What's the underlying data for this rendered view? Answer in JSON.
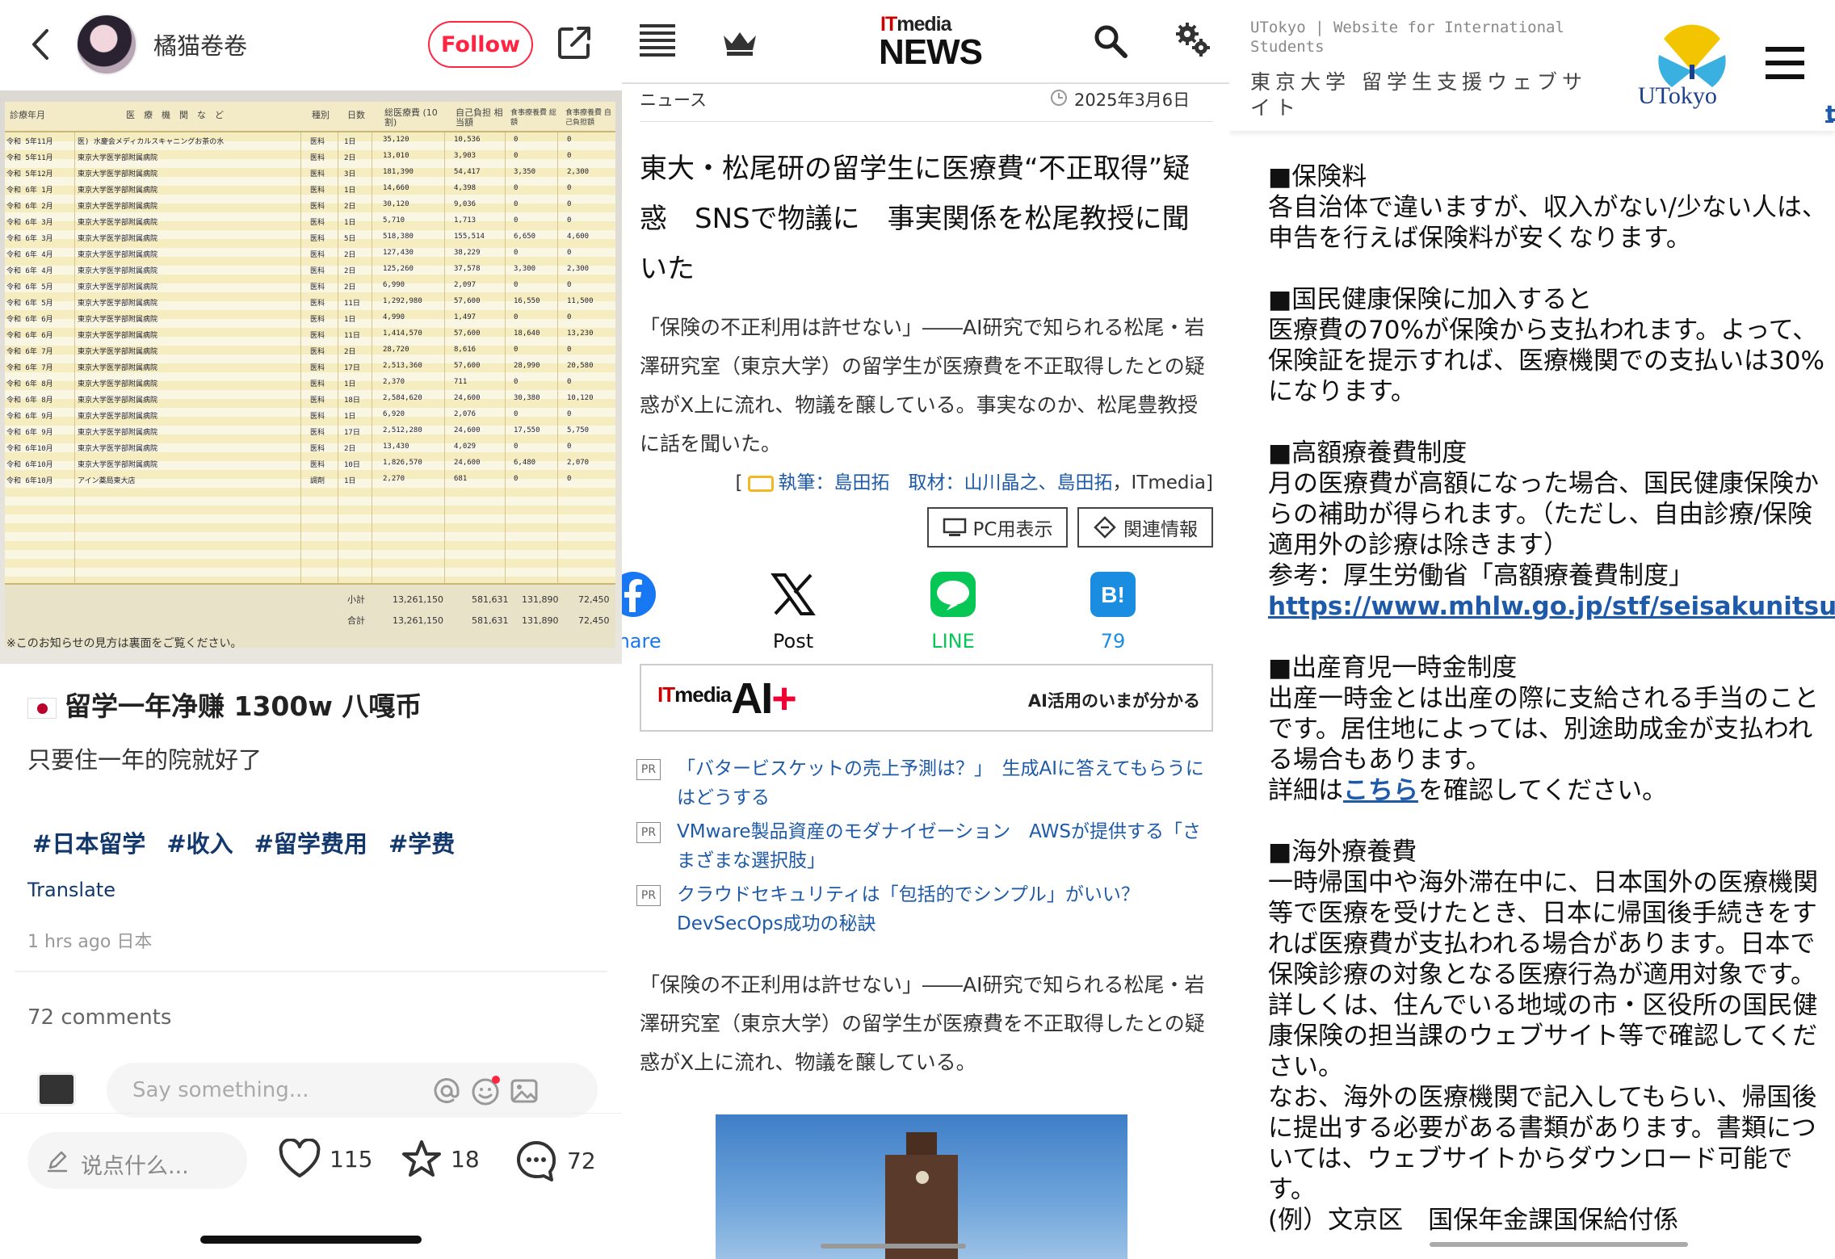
{
  "panel1": {
    "username": "橘猫卷卷",
    "follow_label": "Follow",
    "receipt": {
      "headers": [
        "診療年月",
        "医　療　機　関　な　ど",
        "種別",
        "日数",
        "総医療費\n(10割)",
        "自己負担\n相当額",
        "食事療養費\n総額",
        "食事療養費\n自己負担額"
      ],
      "rows": [
        [
          "令和 5年11月",
          "医) 水慶会メディカルスキャニングお茶の水",
          "医科",
          "1日",
          "35,120",
          "10,536",
          "0",
          "0"
        ],
        [
          "令和 5年11月",
          "東京大学医学部附属病院",
          "医科",
          "2日",
          "13,010",
          "3,903",
          "0",
          "0"
        ],
        [
          "令和 5年12月",
          "東京大学医学部附属病院",
          "医科",
          "3日",
          "181,390",
          "54,417",
          "3,350",
          "2,300"
        ],
        [
          "令和 6年 1月",
          "東京大学医学部附属病院",
          "医科",
          "1日",
          "14,660",
          "4,398",
          "0",
          "0"
        ],
        [
          "令和 6年 2月",
          "東京大学医学部附属病院",
          "医科",
          "2日",
          "30,120",
          "9,036",
          "0",
          "0"
        ],
        [
          "令和 6年 3月",
          "東京大学医学部附属病院",
          "医科",
          "1日",
          "5,710",
          "1,713",
          "0",
          "0"
        ],
        [
          "令和 6年 3月",
          "東京大学医学部附属病院",
          "医科",
          "5日",
          "518,380",
          "155,514",
          "6,650",
          "4,600"
        ],
        [
          "令和 6年 4月",
          "東京大学医学部附属病院",
          "医科",
          "2日",
          "127,430",
          "38,229",
          "0",
          "0"
        ],
        [
          "令和 6年 4月",
          "東京大学医学部附属病院",
          "医科",
          "2日",
          "125,260",
          "37,578",
          "3,300",
          "2,300"
        ],
        [
          "令和 6年 5月",
          "東京大学医学部附属病院",
          "医科",
          "2日",
          "6,990",
          "2,097",
          "0",
          "0"
        ],
        [
          "令和 6年 5月",
          "東京大学医学部附属病院",
          "医科",
          "11日",
          "1,292,980",
          "57,600",
          "16,550",
          "11,500"
        ],
        [
          "令和 6年 6月",
          "東京大学医学部附属病院",
          "医科",
          "1日",
          "4,990",
          "1,497",
          "0",
          "0"
        ],
        [
          "令和 6年 6月",
          "東京大学医学部附属病院",
          "医科",
          "11日",
          "1,414,570",
          "57,600",
          "18,640",
          "13,230"
        ],
        [
          "令和 6年 7月",
          "東京大学医学部附属病院",
          "医科",
          "2日",
          "28,720",
          "8,616",
          "0",
          "0"
        ],
        [
          "令和 6年 7月",
          "東京大学医学部附属病院",
          "医科",
          "17日",
          "2,513,360",
          "57,600",
          "28,990",
          "20,580"
        ],
        [
          "令和 6年 8月",
          "東京大学医学部附属病院",
          "医科",
          "1日",
          "2,370",
          "711",
          "0",
          "0"
        ],
        [
          "令和 6年 8月",
          "東京大学医学部附属病院",
          "医科",
          "18日",
          "2,584,620",
          "24,600",
          "30,380",
          "10,120"
        ],
        [
          "令和 6年 9月",
          "東京大学医学部附属病院",
          "医科",
          "1日",
          "6,920",
          "2,076",
          "0",
          "0"
        ],
        [
          "令和 6年 9月",
          "東京大学医学部附属病院",
          "医科",
          "17日",
          "2,512,280",
          "24,600",
          "17,550",
          "5,750"
        ],
        [
          "令和 6年10月",
          "東京大学医学部附属病院",
          "医科",
          "2日",
          "13,430",
          "4,029",
          "0",
          "0"
        ],
        [
          "令和 6年10月",
          "東京大学医学部附属病院",
          "医科",
          "10日",
          "1,826,570",
          "24,600",
          "6,480",
          "2,070"
        ],
        [
          "令和 6年10月",
          "アイン薬局東大店",
          "調剤",
          "1日",
          "2,270",
          "681",
          "0",
          "0"
        ]
      ],
      "subtotal_label": "小計",
      "total_label": "合計",
      "subtotal": [
        "13,261,150",
        "581,631",
        "131,890",
        "72,450"
      ],
      "total": [
        "13,261,150",
        "581,631",
        "131,890",
        "72,450"
      ],
      "note": "※このお知らせの見方は裏面をご覧ください。"
    },
    "title": "留学一年净赚 1300w 八嘎币",
    "text": "只要住一年的院就好了",
    "tags": [
      "#日本留学",
      "#收入",
      "#留学费用",
      "#学费"
    ],
    "translate": "Translate",
    "time": "1 hrs ago 日本",
    "comments_count": "72 comments",
    "comment_placeholder": "Say something...",
    "bottom_input": "说点什么...",
    "likes": "115",
    "stars": "18",
    "comments": "72"
  },
  "panel2": {
    "logo_it": "IT",
    "logo_media": "media",
    "logo_news": "NEWS",
    "section": "ニュース",
    "date": "2025年3月6日",
    "title": "東大・松尾研の留学生に医療費“不正取得”疑惑　SNSで物議に　事実関係を松尾教授に聞いた",
    "lead": "「保険の不正利用は許せない」――AI研究で知られる松尾・岩澤研究室（東京大学）の留学生が医療費を不正取得したとの疑惑がX上に流れ、物議を醸している。事実なのか、松尾豊教授に話を聞いた。",
    "byline_open": "[",
    "byline_author": "執筆：島田拓",
    "byline_reporters": "取材：山川晶之、島田拓",
    "byline_source": "ITmedia",
    "byline_close": "]",
    "pc_view": "PC用表示",
    "related": "関連情報",
    "sns": [
      {
        "label": "Share",
        "color": "#1877f2"
      },
      {
        "label": "Post",
        "color": "#111111"
      },
      {
        "label": "LINE",
        "color": "#06c755"
      },
      {
        "label": "79",
        "color": "#1a8de0"
      }
    ],
    "line_icon_text": "LINE",
    "hatena_icon_text": "B!",
    "ai_banner_it": "IT",
    "ai_banner_media": "media",
    "ai_banner_ai": "AI",
    "ai_banner_plus": "+",
    "ai_tagline": "AI活用のいまが分かる",
    "pr_badge": "PR",
    "pr_items": [
      "「バタービスケットの売上予測は？」　生成AIに答えてもらうにはどうする",
      "VMware製品資産のモダナイゼーション　AWSが提供する「さまざまな選択肢」",
      "クラウドセキュリティは「包括的でシンプル」がいい？　DevSecOps成功の秘訣"
    ],
    "body": "「保険の不正利用は許せない」――AI研究で知られる松尾・岩澤研究室（東京大学）の留学生が医療費を不正取得したとの疑惑がX上に流れ、物議を醸している。"
  },
  "panel3": {
    "site_en": "UTokyo | Website for International Students",
    "site_jp": "東京大学 留学生支援ウェブサイト",
    "logo_text": "UTokyo",
    "edge_letter": "t",
    "sections": [
      {
        "heading": "■保険料",
        "lines": [
          "各自治体で違いますが、収入がない/少ない人は、申告を行えば保険料が安くなります。"
        ]
      },
      {
        "heading": "■国民健康保険に加入すると",
        "lines": [
          "医療費の70%が保険から支払われます。よって、保険証を提示すれば、医療機関での支払いは30%になります。"
        ]
      },
      {
        "heading": "■高額療養費制度",
        "lines": [
          "月の医療費が高額になった場合、国民健康保険からの補助が得られます。（ただし、自由診療/保険適用外の診療は除きます）",
          "参考：厚生労働省「高額療養費制度」"
        ],
        "link": "https://www.mhlw.go.jp/stf/seisakunitsuite/bun"
      },
      {
        "heading": "■出産育児一時金制度",
        "lines": [
          "出産一時金とは出産の際に支給される手当のことです。居住地によっては、別途助成金が支払われる場合もあります。"
        ],
        "detail_pre": "詳細は",
        "detail_link": "こちら",
        "detail_post": "を確認してください。"
      },
      {
        "heading": "■海外療養費",
        "lines": [
          "一時帰国中や海外滞在中に、日本国外の医療機関等で医療を受けたとき、日本に帰国後手続きをすれば医療費が支払われる場合があります。日本で保険診療の対象となる医療行為が適用対象です。",
          "詳しくは、住んでいる地域の市・区役所の国民健康保険の担当課のウェブサイト等で確認してください。",
          "なお、海外の医療機関で記入してもらい、帰国後に提出する必要がある書類があります。書類については、ウェブサイトからダウンロード可能です。",
          "(例）文京区　国保年金課国保給付係"
        ]
      }
    ]
  }
}
